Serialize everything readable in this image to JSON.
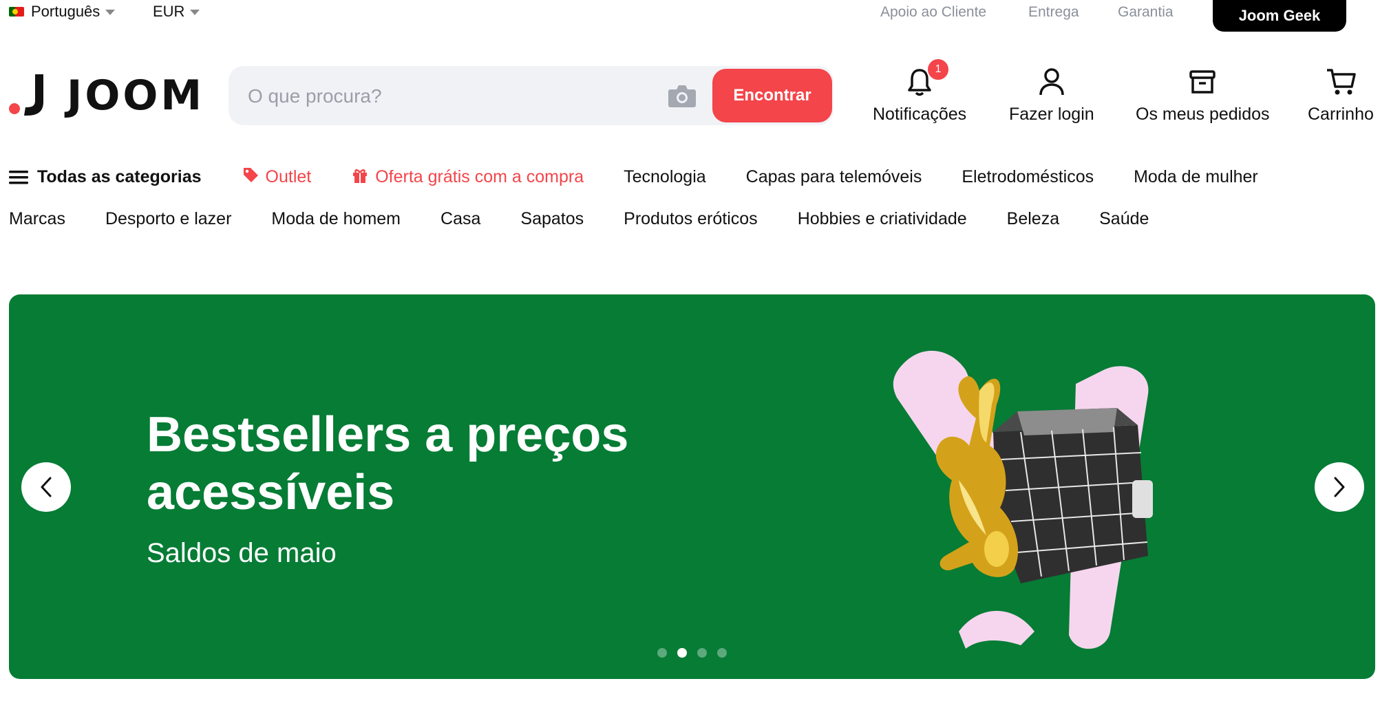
{
  "topbar": {
    "language": "Português",
    "currency": "EUR",
    "links": [
      "Apoio ao Cliente",
      "Entrega",
      "Garantia"
    ],
    "geek_button": "Joom Geek"
  },
  "header": {
    "logo_text": "JOOM",
    "search_placeholder": "O que procura?",
    "search_button": "Encontrar",
    "notifications_label": "Notificações",
    "notifications_count": "1",
    "login_label": "Fazer login",
    "orders_label": "Os meus pedidos",
    "cart_label": "Carrinho"
  },
  "categories": {
    "all": "Todas as categorias",
    "outlet": "Outlet",
    "gift": "Oferta grátis com a compra",
    "row1": [
      "Tecnologia",
      "Capas para telemóveis",
      "Eletrodomésticos",
      "Moda de mulher"
    ],
    "row2": [
      "Marcas",
      "Desporto e lazer",
      "Moda de homem",
      "Casa",
      "Sapatos",
      "Produtos eróticos",
      "Hobbies e criatividade",
      "Beleza",
      "Saúde"
    ]
  },
  "banner": {
    "title": "Bestsellers a preços acessíveis",
    "subtitle": "Saldos de maio",
    "background_color": "#067c35",
    "slide_count": 4,
    "active_slide": 2
  },
  "colors": {
    "accent": "#f3454a",
    "banner_green": "#067c35",
    "muted_text": "#8a8f99"
  }
}
